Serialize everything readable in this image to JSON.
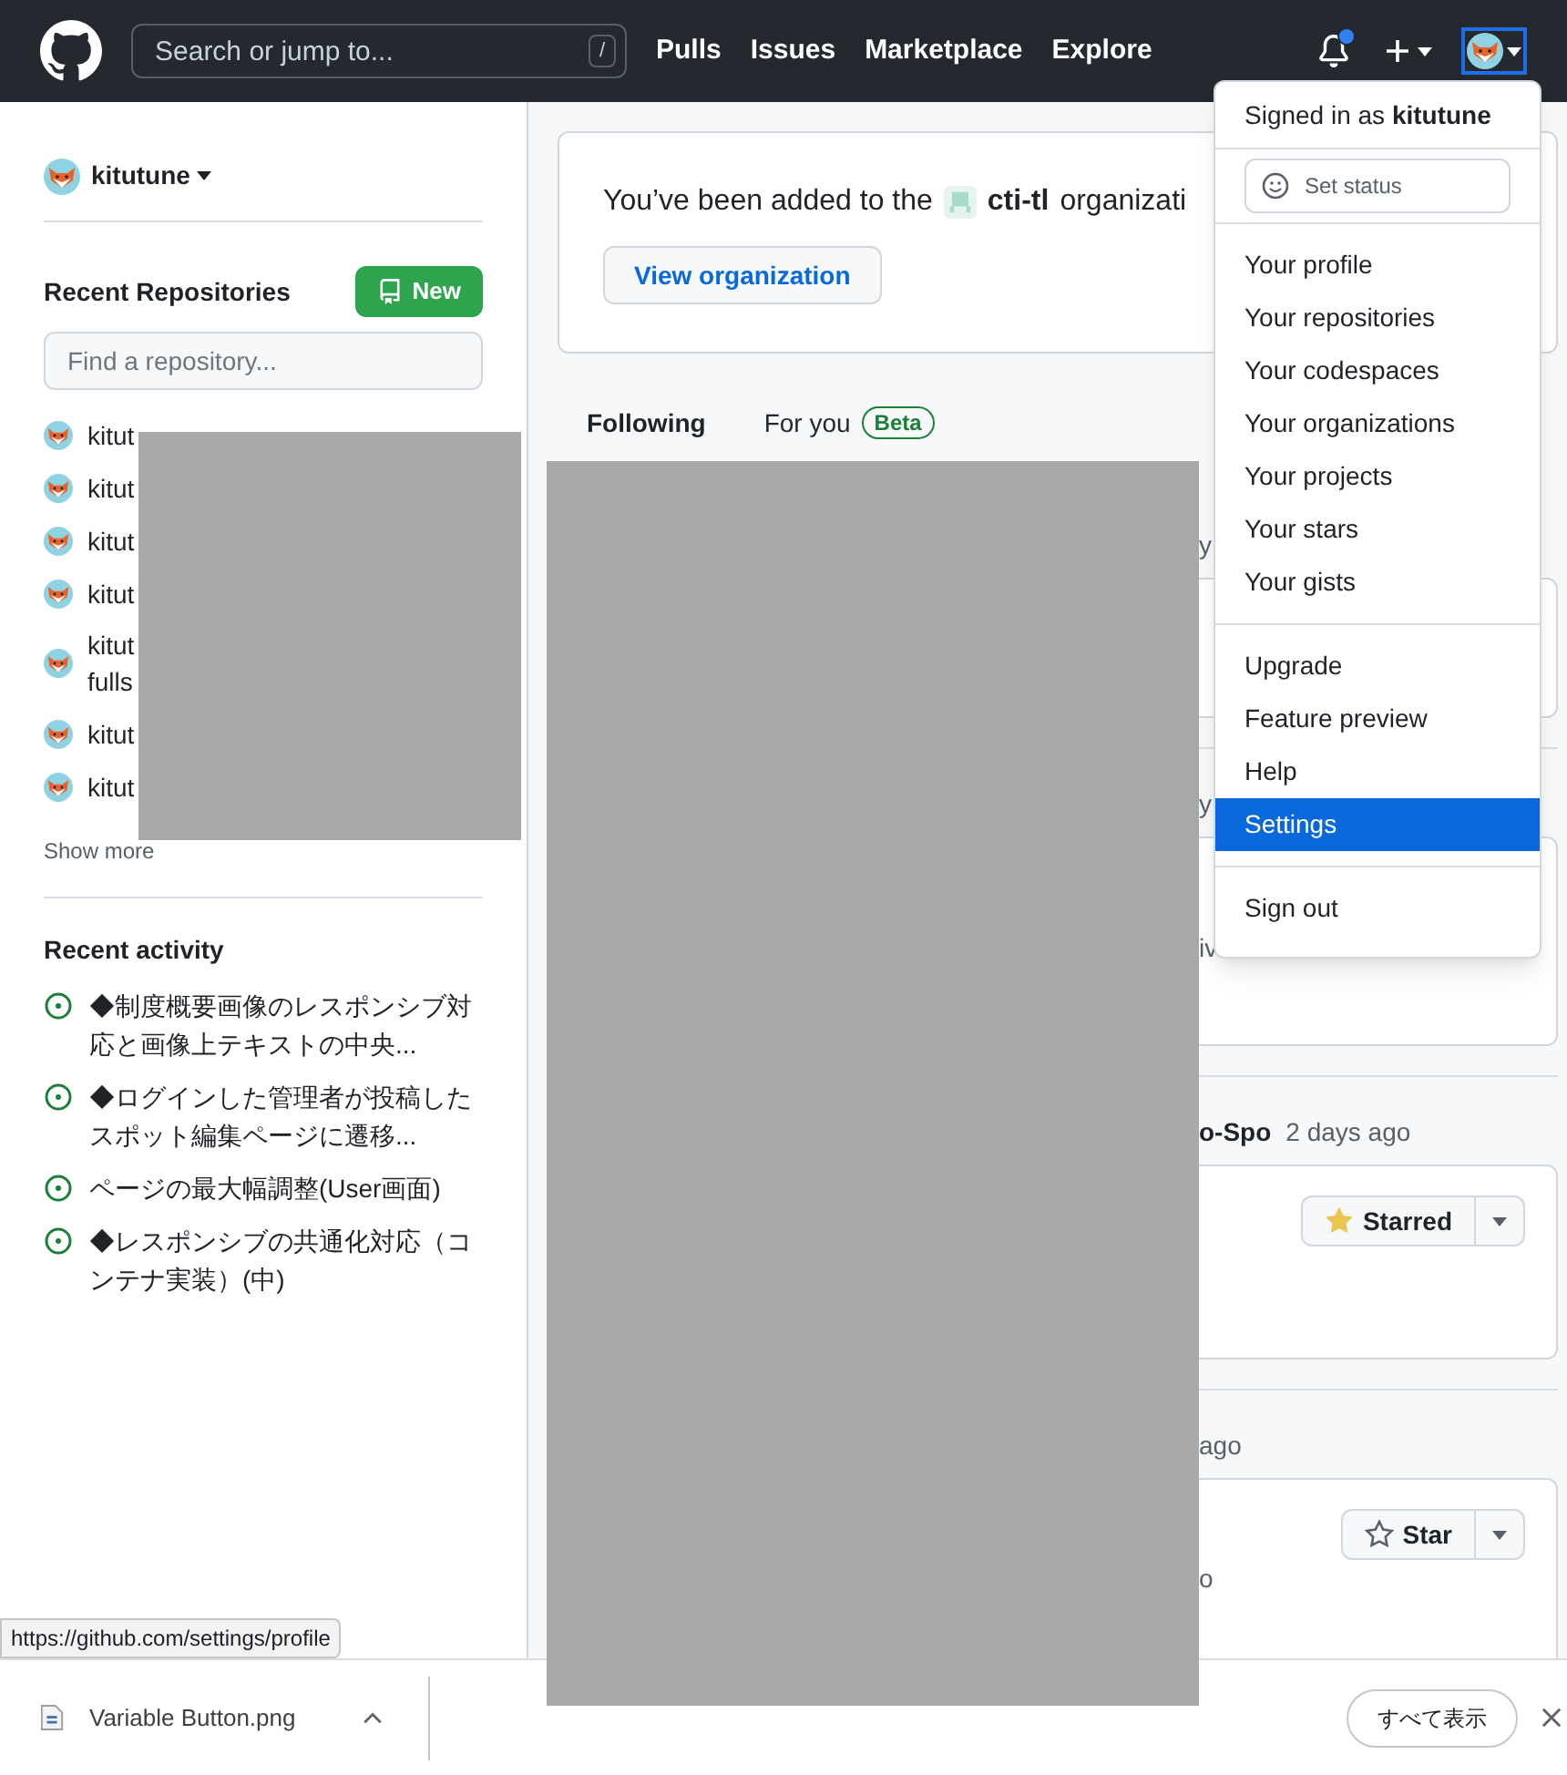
{
  "header": {
    "search": {
      "placeholder": "Search or jump to...",
      "shortcut": "/"
    },
    "nav": [
      "Pulls",
      "Issues",
      "Marketplace",
      "Explore"
    ],
    "notifications_unread": true
  },
  "sidebar": {
    "user": "kitutune",
    "recent_repositories": {
      "title": "Recent Repositories",
      "new_button": "New",
      "filter_placeholder": "Find a repository...",
      "items": [
        {
          "lines": [
            "kitut"
          ]
        },
        {
          "lines": [
            "kitut"
          ]
        },
        {
          "lines": [
            "kitut"
          ]
        },
        {
          "lines": [
            "kitut"
          ]
        },
        {
          "lines": [
            "kitut",
            "fulls"
          ]
        },
        {
          "lines": [
            "kitut"
          ]
        },
        {
          "lines": [
            "kitut"
          ]
        }
      ],
      "show_more": "Show more"
    },
    "recent_activity": {
      "title": "Recent activity",
      "items": [
        "◆制度概要画像のレスポンシブ対応と画像上テキストの中央...",
        "◆ログインした管理者が投稿したスポット編集ページに遷移...",
        "ページの最大幅調整(User画面)",
        "◆レスポンシブの共通化対応（コンテナ実装）(中)"
      ]
    }
  },
  "org_notice": {
    "before": "You’ve been added to the",
    "org": "cti-tl",
    "after": "organizati",
    "button": "View organization"
  },
  "feed_tabs": [
    {
      "label": "Following",
      "selected": true
    },
    {
      "label": "For you",
      "badge": "Beta",
      "selected": false
    }
  ],
  "feed": [
    {
      "heading": "y"
    },
    {
      "heading": "y",
      "card_text": "iv"
    },
    {
      "heading": "o-Spo",
      "time": "2 days ago",
      "star_button": {
        "label": "Starred",
        "starred": true
      }
    },
    {
      "time": "ago",
      "card_text": "o",
      "star_button": {
        "label": "Star",
        "starred": false
      }
    }
  ],
  "user_menu": {
    "signed_in_prefix": "Signed in as",
    "user": "kitutune",
    "set_status": "Set status",
    "groups": [
      [
        {
          "label": "Your profile",
          "selected": false
        },
        {
          "label": "Your repositories",
          "selected": false
        },
        {
          "label": "Your codespaces",
          "selected": false
        },
        {
          "label": "Your organizations",
          "selected": false
        },
        {
          "label": "Your projects",
          "selected": false
        },
        {
          "label": "Your stars",
          "selected": false
        },
        {
          "label": "Your gists",
          "selected": false
        }
      ],
      [
        {
          "label": "Upgrade",
          "selected": false
        },
        {
          "label": "Feature preview",
          "selected": false
        },
        {
          "label": "Help",
          "selected": false
        },
        {
          "label": "Settings",
          "selected": true
        }
      ],
      [
        {
          "label": "Sign out",
          "selected": false
        }
      ]
    ]
  },
  "status_url": "https://github.com/settings/profile",
  "download_bar": {
    "file": "Variable Button.png",
    "show_all": "すべて表示"
  }
}
